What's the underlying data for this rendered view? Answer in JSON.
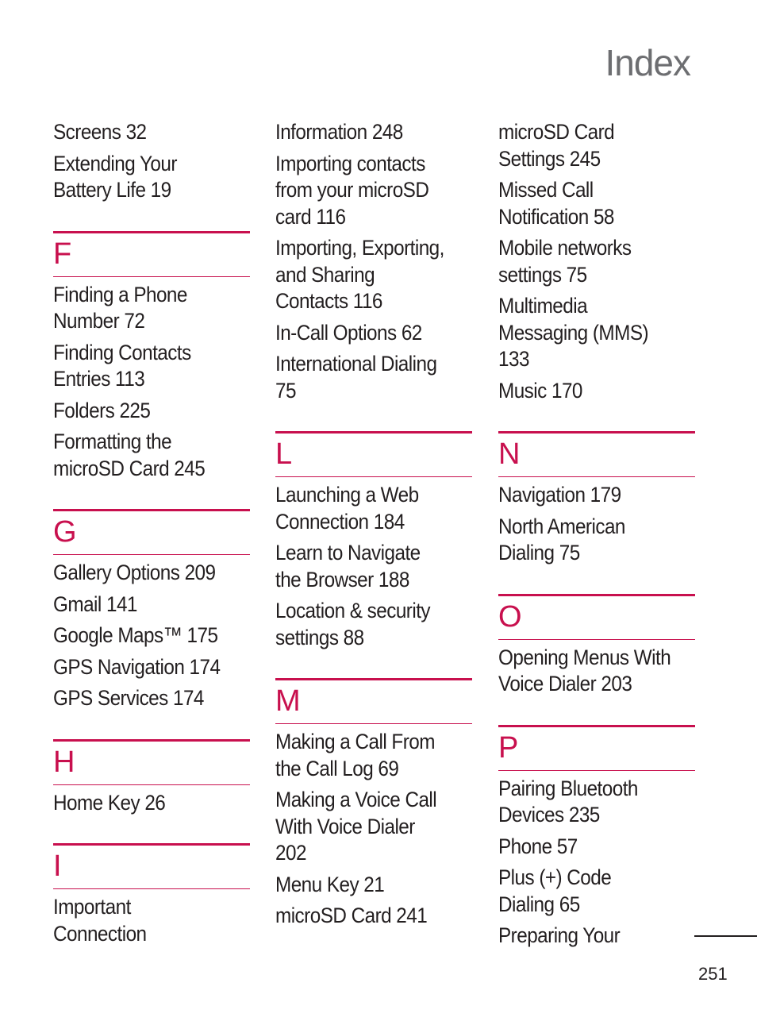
{
  "page": {
    "title": "Index",
    "page_number": "251",
    "accent_color": "#C8104E"
  },
  "columns": [
    {
      "lead_entries": [
        "Screens 32",
        "Extending Your\nBattery Life 19"
      ],
      "sections": [
        {
          "letter": "F",
          "entries": [
            "Finding a Phone\nNumber 72",
            "Finding Contacts\nEntries 113",
            "Folders 225",
            "Formatting the\nmicroSD Card 245"
          ]
        },
        {
          "letter": "G",
          "entries": [
            "Gallery Options 209",
            "Gmail 141",
            "Google Maps™ 175",
            "GPS Navigation 174",
            "GPS Services 174"
          ]
        },
        {
          "letter": "H",
          "entries": [
            "Home Key 26"
          ]
        },
        {
          "letter": "I",
          "entries": [
            "Important\nConnection"
          ]
        }
      ]
    },
    {
      "lead_entries": [
        "Information 248",
        "Importing contacts\nfrom your microSD\ncard 116",
        "Importing, Exporting,\nand Sharing\nContacts 116",
        "In-Call Options 62",
        "International Dialing\n75"
      ],
      "sections": [
        {
          "letter": "L",
          "entries": [
            "Launching a Web\nConnection 184",
            "Learn to Navigate\nthe Browser 188",
            "Location & security\nsettings 88"
          ]
        },
        {
          "letter": "M",
          "entries": [
            "Making a Call From\nthe Call Log 69",
            "Making a Voice Call\nWith Voice Dialer\n202",
            "Menu Key 21",
            "microSD Card 241"
          ]
        }
      ]
    },
    {
      "lead_entries": [
        "microSD Card\nSettings 245",
        "Missed Call\nNotification 58",
        "Mobile networks\nsettings 75",
        "Multimedia\nMessaging (MMS)\n133",
        "Music 170"
      ],
      "sections": [
        {
          "letter": "N",
          "entries": [
            "Navigation 179",
            "North American\nDialing 75"
          ]
        },
        {
          "letter": "O",
          "entries": [
            "Opening Menus With\nVoice Dialer 203"
          ]
        },
        {
          "letter": "P",
          "entries": [
            "Pairing Bluetooth\nDevices 235",
            "Phone 57",
            "Plus (+) Code\nDialing 65",
            "Preparing Your"
          ]
        }
      ]
    }
  ]
}
